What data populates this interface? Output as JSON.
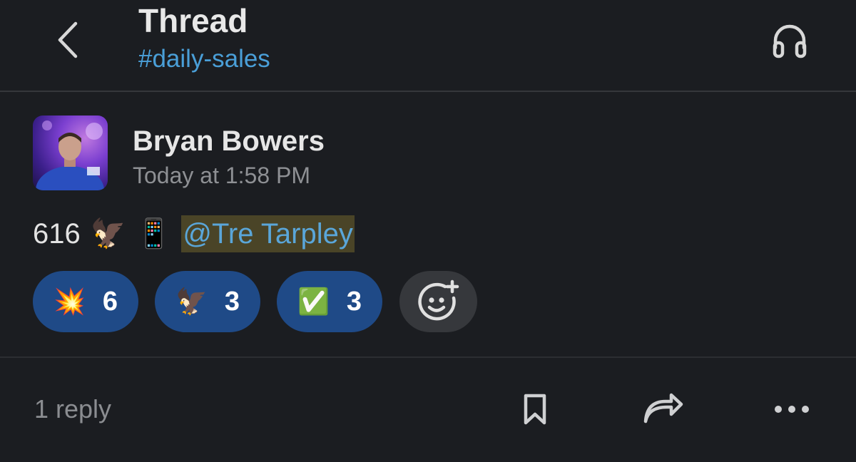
{
  "header": {
    "title": "Thread",
    "channel": "#daily-sales"
  },
  "message": {
    "author": "Bryan Bowers",
    "timestamp": "Today at 1:58 PM",
    "text_prefix": "616",
    "emoji_1": "🦅",
    "emoji_2": "📱",
    "mention": "@Tre Tarpley"
  },
  "reactions": [
    {
      "emoji": "💥",
      "count": "6"
    },
    {
      "emoji": "🦅",
      "count": "3"
    },
    {
      "emoji": "✅",
      "count": "3"
    }
  ],
  "footer": {
    "replies": "1 reply"
  },
  "icons": {
    "back": "chevron-left-icon",
    "huddle": "headphones-icon",
    "add_reaction": "add-emoji-icon",
    "save": "bookmark-icon",
    "share": "share-arrow-icon",
    "more": "more-horizontal-icon"
  },
  "colors": {
    "background": "#1b1d21",
    "link": "#4a9fd8",
    "reaction_bg": "#1f4a87",
    "mention_bg": "#4a4427"
  }
}
